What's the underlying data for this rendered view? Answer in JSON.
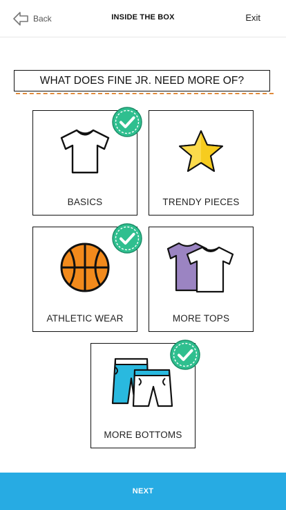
{
  "header": {
    "back_label": "Back",
    "title": "INSIDE THE BOX",
    "exit_label": "Exit"
  },
  "question": "WHAT DOES FINE JR. NEED MORE OF?",
  "options": [
    {
      "label": "BASICS",
      "icon": "t-shirt-icon",
      "selected": true
    },
    {
      "label": "TRENDY PIECES",
      "icon": "star-icon",
      "selected": false
    },
    {
      "label": "ATHLETIC WEAR",
      "icon": "basketball-icon",
      "selected": true
    },
    {
      "label": "MORE TOPS",
      "icon": "tops-icon",
      "selected": false
    },
    {
      "label": "MORE BOTTOMS",
      "icon": "shorts-icon",
      "selected": true
    }
  ],
  "next_label": "NEXT",
  "colors": {
    "accent": "#27abe3",
    "check": "#2fbf8f",
    "star": "#f7cc1f",
    "ball": "#f28a1c",
    "tops_purple": "#9b84c2",
    "shorts_blue": "#29b9df",
    "question_dash": "#e08a3c"
  }
}
